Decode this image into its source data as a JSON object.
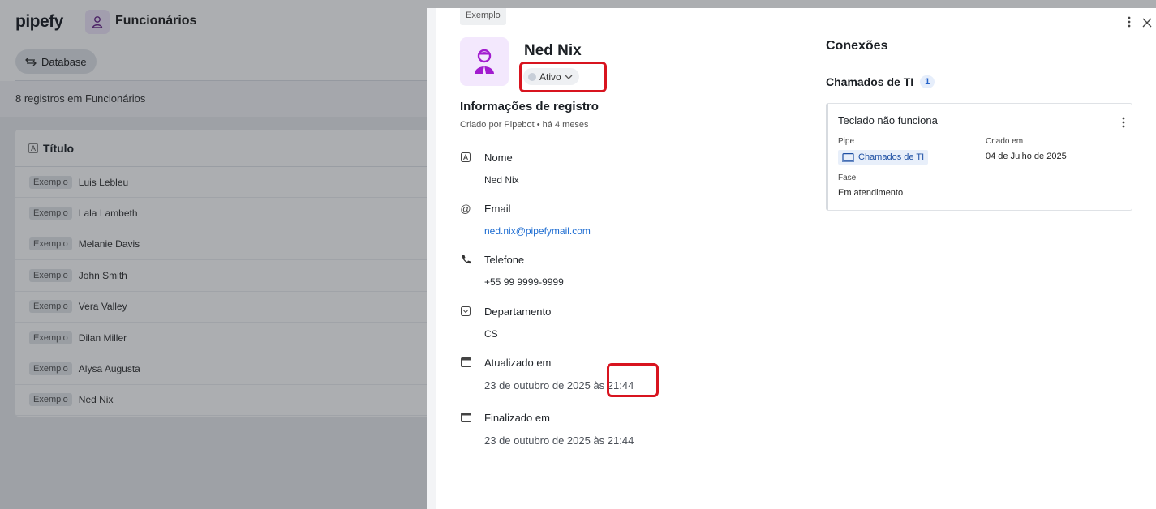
{
  "background": {
    "logo": "pipefy",
    "database_title": "Funcionários",
    "database_button": "Database",
    "records_count": "8 registros em Funcionários",
    "table_header": "Título",
    "rows": [
      {
        "tag": "Exemplo",
        "name": "Luis Lebleu"
      },
      {
        "tag": "Exemplo",
        "name": "Lala Lambeth"
      },
      {
        "tag": "Exemplo",
        "name": "Melanie Davis"
      },
      {
        "tag": "Exemplo",
        "name": "John Smith"
      },
      {
        "tag": "Exemplo",
        "name": "Vera Valley"
      },
      {
        "tag": "Exemplo",
        "name": "Dilan Miller"
      },
      {
        "tag": "Exemplo",
        "name": "Alysa Augusta"
      },
      {
        "tag": "Exemplo",
        "name": "Ned Nix"
      }
    ]
  },
  "record": {
    "tag": "Exemplo",
    "name": "Ned Nix",
    "status": "Ativo",
    "section_title": "Informações de registro",
    "section_subtitle": "Criado por Pipebot • há 4 meses",
    "fields": {
      "nome": {
        "label": "Nome",
        "value": "Ned Nix"
      },
      "email": {
        "label": "Email",
        "value": "ned.nix@pipefymail.com"
      },
      "telefone": {
        "label": "Telefone",
        "value": "+55 99 9999-9999"
      },
      "departamento": {
        "label": "Departamento",
        "value": "CS"
      },
      "atualizado": {
        "label": "Atualizado em",
        "value": "23 de outubro de 2025 às 21:44"
      },
      "finalizado": {
        "label": "Finalizado em",
        "value": "23 de outubro de 2025 às 21:44"
      }
    }
  },
  "connections": {
    "title": "Conexões",
    "group_title": "Chamados de TI",
    "group_count": "1",
    "card": {
      "title": "Teclado não funciona",
      "pipe_label": "Pipe",
      "pipe_value": "Chamados de TI",
      "created_label": "Criado em",
      "created_value": "04 de Julho de 2025",
      "phase_label": "Fase",
      "phase_value": "Em atendimento"
    }
  },
  "colors": {
    "accent": "#1b6bd1",
    "avatar_purple": "#a21ccf",
    "annotation_red": "#d8141f"
  }
}
